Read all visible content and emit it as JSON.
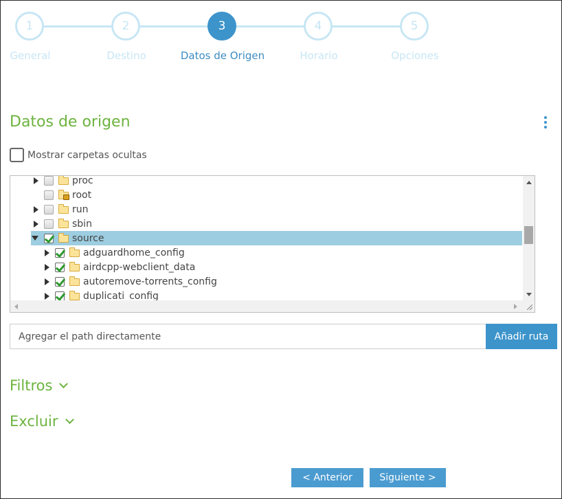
{
  "stepper": {
    "steps": [
      {
        "number": "1",
        "label": "General"
      },
      {
        "number": "2",
        "label": "Destino"
      },
      {
        "number": "3",
        "label": "Datos de Origen"
      },
      {
        "number": "4",
        "label": "Horario"
      },
      {
        "number": "5",
        "label": "Opciones"
      }
    ],
    "active_step": 3
  },
  "section": {
    "title": "Datos de origen",
    "menu_icon": "kebab-menu-icon"
  },
  "show_hidden": {
    "label": "Mostrar carpetas ocultas",
    "checked": false
  },
  "tree": {
    "items": [
      {
        "name": "proc",
        "expandable": true,
        "expanded": false,
        "checked": false,
        "selected": false,
        "level": 0,
        "icon": "folder-icon"
      },
      {
        "name": "root",
        "expandable": false,
        "expanded": false,
        "checked": false,
        "selected": false,
        "level": 0,
        "icon": "folder-locked-icon"
      },
      {
        "name": "run",
        "expandable": true,
        "expanded": false,
        "checked": false,
        "selected": false,
        "level": 0,
        "icon": "folder-icon"
      },
      {
        "name": "sbin",
        "expandable": true,
        "expanded": false,
        "checked": false,
        "selected": false,
        "level": 0,
        "icon": "folder-icon"
      },
      {
        "name": "source",
        "expandable": true,
        "expanded": true,
        "checked": true,
        "selected": true,
        "level": 0,
        "icon": "folder-icon"
      },
      {
        "name": "adguardhome_config",
        "expandable": true,
        "expanded": false,
        "checked": true,
        "selected": false,
        "level": 1,
        "icon": "folder-icon"
      },
      {
        "name": "airdcpp-webclient_data",
        "expandable": true,
        "expanded": false,
        "checked": true,
        "selected": false,
        "level": 1,
        "icon": "folder-icon"
      },
      {
        "name": "autoremove-torrents_config",
        "expandable": true,
        "expanded": false,
        "checked": true,
        "selected": false,
        "level": 1,
        "icon": "folder-icon"
      },
      {
        "name": "duplicati_config",
        "expandable": true,
        "expanded": false,
        "checked": true,
        "selected": false,
        "level": 1,
        "icon": "folder-icon"
      }
    ]
  },
  "path_input": {
    "placeholder": "Agregar el path directamente",
    "value": ""
  },
  "add_path_button": "Añadir ruta",
  "filters": {
    "label": "Filtros"
  },
  "exclude": {
    "label": "Excluir"
  },
  "footer": {
    "prev_label": "< Anterior",
    "next_label": "Siguiente >"
  },
  "colors": {
    "accent_blue": "#3d94cb",
    "accent_green": "#6db33f",
    "inactive_step": "#c7e6f4",
    "selected_row": "#9dcde0"
  }
}
